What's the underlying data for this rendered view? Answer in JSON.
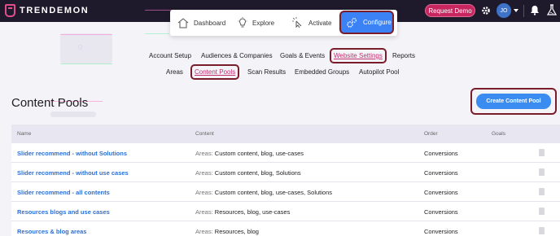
{
  "app": {
    "logo": "TRENDEMON",
    "request_demo": "Request Demo",
    "avatar_initials": "JO"
  },
  "main_nav": [
    {
      "label": "Dashboard",
      "icon": "home-icon"
    },
    {
      "label": "Explore",
      "icon": "bulb-icon"
    },
    {
      "label": "Activate",
      "icon": "cursor-click-icon"
    },
    {
      "label": "Configure",
      "icon": "gears-icon",
      "active": true
    }
  ],
  "sub_nav_row1": [
    "Account Setup",
    "Audiences & Companies",
    "Goals & Events",
    "Website Settings",
    "Reports"
  ],
  "sub_nav_row2": [
    "Areas",
    "Content Pools",
    "Scan Results",
    "Embedded Groups",
    "Autopilot Pool"
  ],
  "page": {
    "title": "Content Pools",
    "create_button": "Create Content Pool"
  },
  "table": {
    "headers": [
      "Name",
      "Content",
      "Order",
      "Goals"
    ],
    "rows": [
      {
        "name": "Slider recommend - without Solutions",
        "content_key": "Areas:",
        "content_value": "Custom content, blog, use-cases",
        "order": "Conversions"
      },
      {
        "name": "Slider recommend - without use cases",
        "content_key": "Areas:",
        "content_value": "Custom content, blog, Solutions",
        "order": "Conversions"
      },
      {
        "name": "Slider recommend - all contents",
        "content_key": "Areas:",
        "content_value": "Custom content, blog, use-cases, Solutions",
        "order": "Conversions"
      },
      {
        "name": "Resources blogs and use cases",
        "content_key": "Areas:",
        "content_value": "Resources, blog, use-cases",
        "order": "Conversions"
      },
      {
        "name": "Resources & blog areas",
        "content_key": "Areas:",
        "content_value": "Resources, blog",
        "order": "Conversions"
      }
    ]
  },
  "colors": {
    "topbar": "#1f1a2b",
    "accent": "#3b82f6",
    "brand": "#c7265f",
    "highlight": "#7b1c2a",
    "link": "#2a6fd6"
  }
}
